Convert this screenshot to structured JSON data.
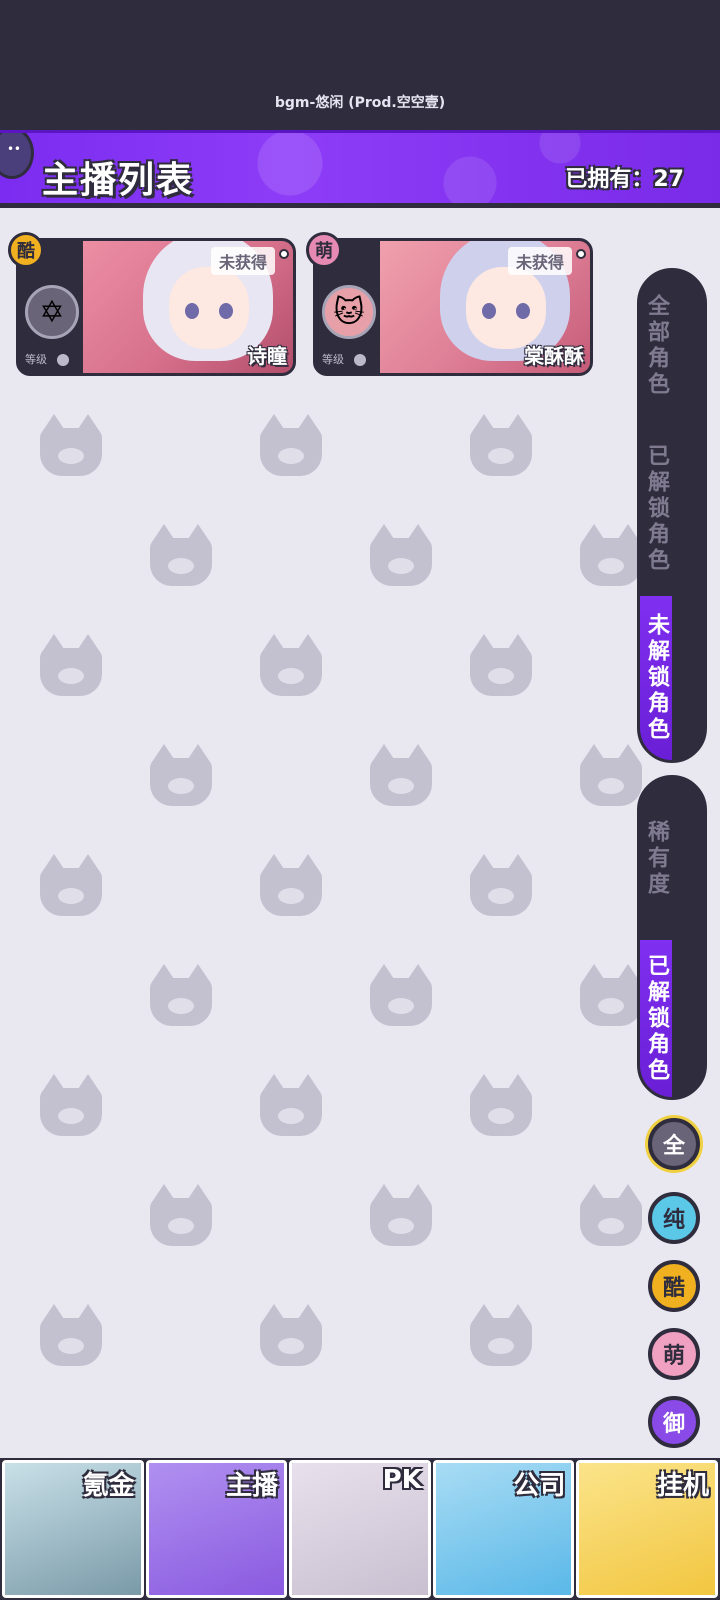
{
  "top_bar": {
    "bgm": "bgm-悠闲 (Prod.空空壹)"
  },
  "header": {
    "title": "主播列表",
    "owned": "已拥有：27"
  },
  "cards": [
    {
      "attribute": "酷",
      "status": "未获得",
      "name": "诗瞳",
      "level_label": "等级",
      "rarity_icon": "star-icon",
      "attr_color": "#f0b020"
    },
    {
      "attribute": "萌",
      "status": "未获得",
      "name": "棠酥酥",
      "level_label": "等级",
      "rarity_icon": "cat-icon",
      "attr_color": "#e68ab4"
    }
  ],
  "filters": {
    "ownership": [
      {
        "label": "全部角色",
        "active": false
      },
      {
        "label": "已解锁角色",
        "active": false
      },
      {
        "label": "未解锁角色",
        "active": true
      }
    ],
    "sort": [
      {
        "label": "稀有度",
        "active": false
      },
      {
        "label": "已解锁角色",
        "active": true
      }
    ],
    "elements": [
      {
        "label": "全",
        "color": "#6a6478",
        "text_color": "#ffffff",
        "selected": true
      },
      {
        "label": "纯",
        "color": "#5cc8e8",
        "text_color": "#2f2d3d",
        "selected": false
      },
      {
        "label": "酷",
        "color": "#f0b020",
        "text_color": "#2f2d3d",
        "selected": false
      },
      {
        "label": "萌",
        "color": "#f0a0c0",
        "text_color": "#2f2d3d",
        "selected": false
      },
      {
        "label": "御",
        "color": "#8a4ae8",
        "text_color": "#ffffff",
        "selected": false
      }
    ]
  },
  "bottom_nav": [
    {
      "label": "氪金",
      "color": "#7a9aa8",
      "active": false
    },
    {
      "label": "主播",
      "color": "#8a5ae0",
      "active": true
    },
    {
      "label": "PK",
      "color": "#c8c0d0",
      "active": false
    },
    {
      "label": "公司",
      "color": "#5ab8e8",
      "active": false
    },
    {
      "label": "挂机",
      "color": "#f2c640",
      "active": false
    }
  ]
}
